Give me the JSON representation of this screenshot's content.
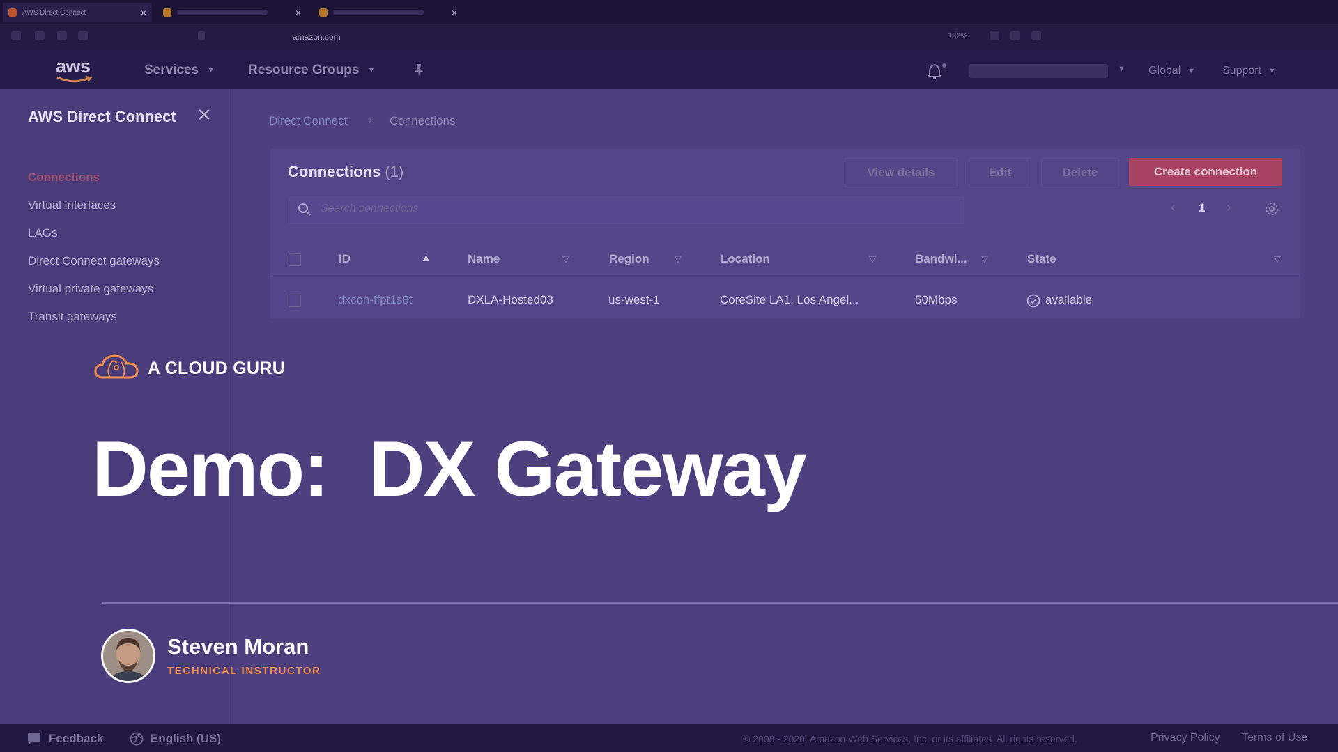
{
  "browser": {
    "tabs": [
      {
        "title": "AWS Direct Connect",
        "close": "×"
      },
      {
        "title": "",
        "close": "×"
      },
      {
        "title": "",
        "close": "×"
      }
    ],
    "url_domain": "amazon.com",
    "zoom": "133%"
  },
  "aws_header": {
    "logo": "aws",
    "services": "Services",
    "resource_groups": "Resource Groups",
    "region": "Global",
    "support": "Support"
  },
  "sidebar": {
    "title": "AWS Direct Connect",
    "items": [
      {
        "label": "Connections",
        "active": true
      },
      {
        "label": "Virtual interfaces"
      },
      {
        "label": "LAGs"
      },
      {
        "label": "Direct Connect gateways"
      },
      {
        "label": "Virtual private gateways"
      },
      {
        "label": "Transit gateways"
      }
    ]
  },
  "breadcrumb": [
    "Direct Connect",
    "Connections"
  ],
  "connections": {
    "title": "Connections",
    "count": "(1)",
    "buttons": {
      "view_details": "View details",
      "edit": "Edit",
      "delete": "Delete",
      "create": "Create connection"
    },
    "search_placeholder": "Search connections",
    "page": "1",
    "columns": [
      "ID",
      "Name",
      "Region",
      "Location",
      "Bandwi...",
      "State"
    ],
    "rows": [
      {
        "id": "dxcon-ffpt1s8t",
        "name": "DXLA-Hosted03",
        "region": "us-west-1",
        "location": "CoreSite LA1, Los Angel...",
        "bandwidth": "50Mbps",
        "state": "available"
      }
    ]
  },
  "overlay": {
    "brand": "A CLOUD GURU",
    "headline": "Demo:  DX Gateway",
    "presenter_name": "Steven Moran",
    "presenter_role": "TECHNICAL INSTRUCTOR"
  },
  "footer": {
    "feedback": "Feedback",
    "language": "English (US)",
    "copyright": "© 2008 - 2020, Amazon Web Services, Inc. or its affiliates. All rights reserved.",
    "privacy": "Privacy Policy",
    "terms": "Terms of Use"
  },
  "colors": {
    "overlay_bg": "#4e3f7e",
    "brand_orange": "#f28d49",
    "create_button": "#a84361"
  }
}
